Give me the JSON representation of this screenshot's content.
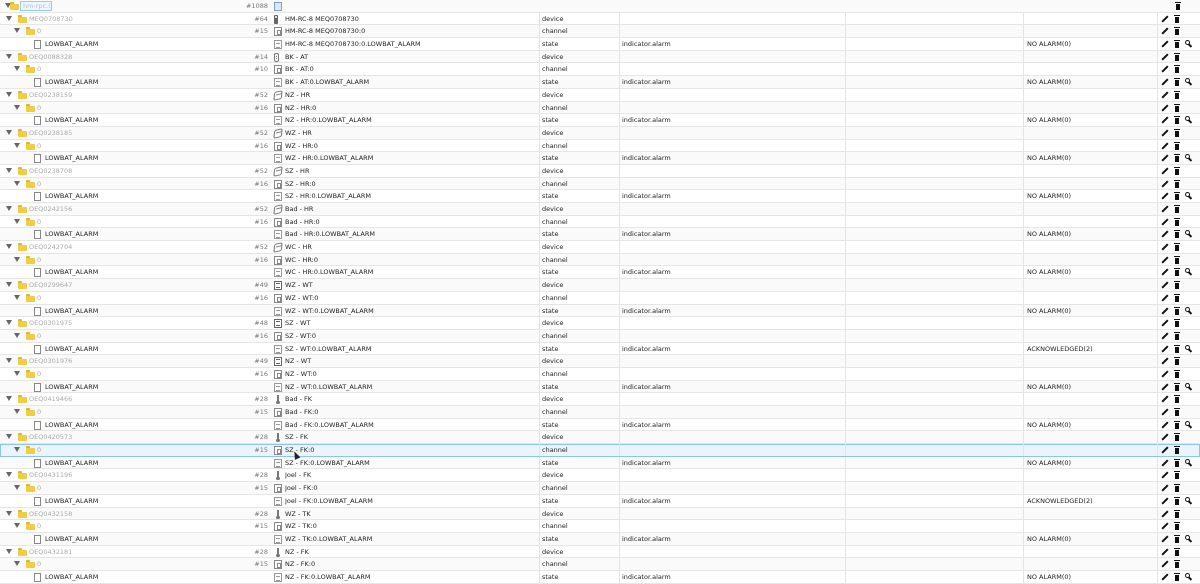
{
  "root": {
    "label": "hm-rpc.0",
    "count": "#1088"
  },
  "actions": {
    "edit": "pencil-icon",
    "delete": "trash-icon",
    "custom": "wrench-icon"
  },
  "rows": [
    {
      "level": 0,
      "kind": "device",
      "id": "MEQ0708730",
      "count": "#64",
      "icon": "remote",
      "name": "HM-RC-8 MEQ0708730",
      "type": "device",
      "role": "",
      "value": ""
    },
    {
      "level": 1,
      "kind": "channel",
      "id": "0",
      "count": "#15",
      "icon": "ch",
      "name": "HM-RC-8 MEQ0708730:0",
      "type": "channel",
      "role": "",
      "value": ""
    },
    {
      "level": 2,
      "kind": "state",
      "id": "LOWBAT_ALARM",
      "count": "",
      "icon": "st",
      "name": "HM-RC-8 MEQ0708730:0.LOWBAT_ALARM",
      "type": "state",
      "role": "indicator.alarm",
      "value": "NO ALARM(0)"
    },
    {
      "level": 0,
      "kind": "device",
      "id": "OEQ0088328",
      "count": "#14",
      "icon": "sensor",
      "name": "BK - AT",
      "type": "device",
      "role": "",
      "value": ""
    },
    {
      "level": 1,
      "kind": "channel",
      "id": "0",
      "count": "#10",
      "icon": "ch",
      "name": "BK - AT:0",
      "type": "channel",
      "role": "",
      "value": ""
    },
    {
      "level": 2,
      "kind": "state",
      "id": "LOWBAT_ALARM",
      "count": "",
      "icon": "st",
      "name": "BK - AT:0.LOWBAT_ALARM",
      "type": "state",
      "role": "indicator.alarm",
      "value": "NO ALARM(0)"
    },
    {
      "level": 0,
      "kind": "device",
      "id": "OEQ0238159",
      "count": "#52",
      "icon": "valve",
      "name": "NZ - HR",
      "type": "device",
      "role": "",
      "value": ""
    },
    {
      "level": 1,
      "kind": "channel",
      "id": "0",
      "count": "#16",
      "icon": "ch",
      "name": "NZ - HR:0",
      "type": "channel",
      "role": "",
      "value": ""
    },
    {
      "level": 2,
      "kind": "state",
      "id": "LOWBAT_ALARM",
      "count": "",
      "icon": "st",
      "name": "NZ - HR:0.LOWBAT_ALARM",
      "type": "state",
      "role": "indicator.alarm",
      "value": "NO ALARM(0)"
    },
    {
      "level": 0,
      "kind": "device",
      "id": "OEQ0238185",
      "count": "#52",
      "icon": "valve",
      "name": "WZ - HR",
      "type": "device",
      "role": "",
      "value": ""
    },
    {
      "level": 1,
      "kind": "channel",
      "id": "0",
      "count": "#16",
      "icon": "ch",
      "name": "WZ - HR:0",
      "type": "channel",
      "role": "",
      "value": ""
    },
    {
      "level": 2,
      "kind": "state",
      "id": "LOWBAT_ALARM",
      "count": "",
      "icon": "st",
      "name": "WZ - HR:0.LOWBAT_ALARM",
      "type": "state",
      "role": "indicator.alarm",
      "value": "NO ALARM(0)"
    },
    {
      "level": 0,
      "kind": "device",
      "id": "OEQ0238708",
      "count": "#52",
      "icon": "valve",
      "name": "SZ - HR",
      "type": "device",
      "role": "",
      "value": ""
    },
    {
      "level": 1,
      "kind": "channel",
      "id": "0",
      "count": "#16",
      "icon": "ch",
      "name": "SZ - HR:0",
      "type": "channel",
      "role": "",
      "value": ""
    },
    {
      "level": 2,
      "kind": "state",
      "id": "LOWBAT_ALARM",
      "count": "",
      "icon": "st",
      "name": "SZ - HR:0.LOWBAT_ALARM",
      "type": "state",
      "role": "indicator.alarm",
      "value": "NO ALARM(0)"
    },
    {
      "level": 0,
      "kind": "device",
      "id": "OEQ0242156",
      "count": "#52",
      "icon": "valve",
      "name": "Bad - HR",
      "type": "device",
      "role": "",
      "value": ""
    },
    {
      "level": 1,
      "kind": "channel",
      "id": "0",
      "count": "#16",
      "icon": "ch",
      "name": "Bad - HR:0",
      "type": "channel",
      "role": "",
      "value": ""
    },
    {
      "level": 2,
      "kind": "state",
      "id": "LOWBAT_ALARM",
      "count": "",
      "icon": "st",
      "name": "Bad - HR:0.LOWBAT_ALARM",
      "type": "state",
      "role": "indicator.alarm",
      "value": "NO ALARM(0)"
    },
    {
      "level": 0,
      "kind": "device",
      "id": "OEQ0242704",
      "count": "#52",
      "icon": "valve",
      "name": "WC - HR",
      "type": "device",
      "role": "",
      "value": ""
    },
    {
      "level": 1,
      "kind": "channel",
      "id": "0",
      "count": "#16",
      "icon": "ch",
      "name": "WC - HR:0",
      "type": "channel",
      "role": "",
      "value": ""
    },
    {
      "level": 2,
      "kind": "state",
      "id": "LOWBAT_ALARM",
      "count": "",
      "icon": "st",
      "name": "WC - HR:0.LOWBAT_ALARM",
      "type": "state",
      "role": "indicator.alarm",
      "value": "NO ALARM(0)"
    },
    {
      "level": 0,
      "kind": "device",
      "id": "OEQ0299647",
      "count": "#49",
      "icon": "sq",
      "name": "WZ - WT",
      "type": "device",
      "role": "",
      "value": ""
    },
    {
      "level": 1,
      "kind": "channel",
      "id": "0",
      "count": "#16",
      "icon": "ch",
      "name": "WZ - WT:0",
      "type": "channel",
      "role": "",
      "value": ""
    },
    {
      "level": 2,
      "kind": "state",
      "id": "LOWBAT_ALARM",
      "count": "",
      "icon": "st",
      "name": "WZ - WT:0.LOWBAT_ALARM",
      "type": "state",
      "role": "indicator.alarm",
      "value": "NO ALARM(0)"
    },
    {
      "level": 0,
      "kind": "device",
      "id": "OEQ0301975",
      "count": "#48",
      "icon": "sq",
      "name": "SZ - WT",
      "type": "device",
      "role": "",
      "value": ""
    },
    {
      "level": 1,
      "kind": "channel",
      "id": "0",
      "count": "#16",
      "icon": "ch",
      "name": "SZ - WT:0",
      "type": "channel",
      "role": "",
      "value": ""
    },
    {
      "level": 2,
      "kind": "state",
      "id": "LOWBAT_ALARM",
      "count": "",
      "icon": "st",
      "name": "SZ - WT:0.LOWBAT_ALARM",
      "type": "state",
      "role": "indicator.alarm",
      "value": "ACKNOWLEDGED(2)"
    },
    {
      "level": 0,
      "kind": "device",
      "id": "OEQ0301976",
      "count": "#49",
      "icon": "sq",
      "name": "NZ - WT",
      "type": "device",
      "role": "",
      "value": ""
    },
    {
      "level": 1,
      "kind": "channel",
      "id": "0",
      "count": "#16",
      "icon": "ch",
      "name": "NZ - WT:0",
      "type": "channel",
      "role": "",
      "value": ""
    },
    {
      "level": 2,
      "kind": "state",
      "id": "LOWBAT_ALARM",
      "count": "",
      "icon": "st",
      "name": "NZ - WT:0.LOWBAT_ALARM",
      "type": "state",
      "role": "indicator.alarm",
      "value": "NO ALARM(0)"
    },
    {
      "level": 0,
      "kind": "device",
      "id": "OEQ0419466",
      "count": "#28",
      "icon": "thermo",
      "name": "Bad - FK",
      "type": "device",
      "role": "",
      "value": ""
    },
    {
      "level": 1,
      "kind": "channel",
      "id": "0",
      "count": "#15",
      "icon": "ch",
      "name": "Bad - FK:0",
      "type": "channel",
      "role": "",
      "value": ""
    },
    {
      "level": 2,
      "kind": "state",
      "id": "LOWBAT_ALARM",
      "count": "",
      "icon": "st",
      "name": "Bad - FK:0.LOWBAT_ALARM",
      "type": "state",
      "role": "indicator.alarm",
      "value": "NO ALARM(0)"
    },
    {
      "level": 0,
      "kind": "device",
      "id": "OEQ0420573",
      "count": "#28",
      "icon": "thermo",
      "name": "SZ - FK",
      "type": "device",
      "role": "",
      "value": ""
    },
    {
      "level": 1,
      "kind": "channel",
      "id": "0",
      "count": "#15",
      "icon": "ch",
      "name": "SZ - FK:0",
      "type": "channel",
      "role": "",
      "value": "",
      "highlight": true
    },
    {
      "level": 2,
      "kind": "state",
      "id": "LOWBAT_ALARM",
      "count": "",
      "icon": "st",
      "name": "SZ - FK:0.LOWBAT_ALARM",
      "type": "state",
      "role": "indicator.alarm",
      "value": "NO ALARM(0)"
    },
    {
      "level": 0,
      "kind": "device",
      "id": "OEQ0431196",
      "count": "#28",
      "icon": "thermo",
      "name": "Joel - FK",
      "type": "device",
      "role": "",
      "value": ""
    },
    {
      "level": 1,
      "kind": "channel",
      "id": "0",
      "count": "#15",
      "icon": "ch",
      "name": "Joel - FK:0",
      "type": "channel",
      "role": "",
      "value": ""
    },
    {
      "level": 2,
      "kind": "state",
      "id": "LOWBAT_ALARM",
      "count": "",
      "icon": "st",
      "name": "Joel - FK:0.LOWBAT_ALARM",
      "type": "state",
      "role": "indicator.alarm",
      "value": "ACKNOWLEDGED(2)"
    },
    {
      "level": 0,
      "kind": "device",
      "id": "OEQ0432158",
      "count": "#28",
      "icon": "thermo",
      "name": "WZ - TK",
      "type": "device",
      "role": "",
      "value": ""
    },
    {
      "level": 1,
      "kind": "channel",
      "id": "0",
      "count": "#15",
      "icon": "ch",
      "name": "WZ - TK:0",
      "type": "channel",
      "role": "",
      "value": ""
    },
    {
      "level": 2,
      "kind": "state",
      "id": "LOWBAT_ALARM",
      "count": "",
      "icon": "st",
      "name": "WZ - TK:0.LOWBAT_ALARM",
      "type": "state",
      "role": "indicator.alarm",
      "value": "NO ALARM(0)"
    },
    {
      "level": 0,
      "kind": "device",
      "id": "OEQ0432181",
      "count": "#28",
      "icon": "thermo",
      "name": "NZ - FK",
      "type": "device",
      "role": "",
      "value": ""
    },
    {
      "level": 1,
      "kind": "channel",
      "id": "0",
      "count": "#15",
      "icon": "ch",
      "name": "NZ - FK:0",
      "type": "channel",
      "role": "",
      "value": ""
    },
    {
      "level": 2,
      "kind": "state",
      "id": "LOWBAT_ALARM",
      "count": "",
      "icon": "st",
      "name": "NZ - FK:0.LOWBAT_ALARM",
      "type": "state",
      "role": "indicator.alarm",
      "value": "NO ALARM(0)"
    }
  ]
}
